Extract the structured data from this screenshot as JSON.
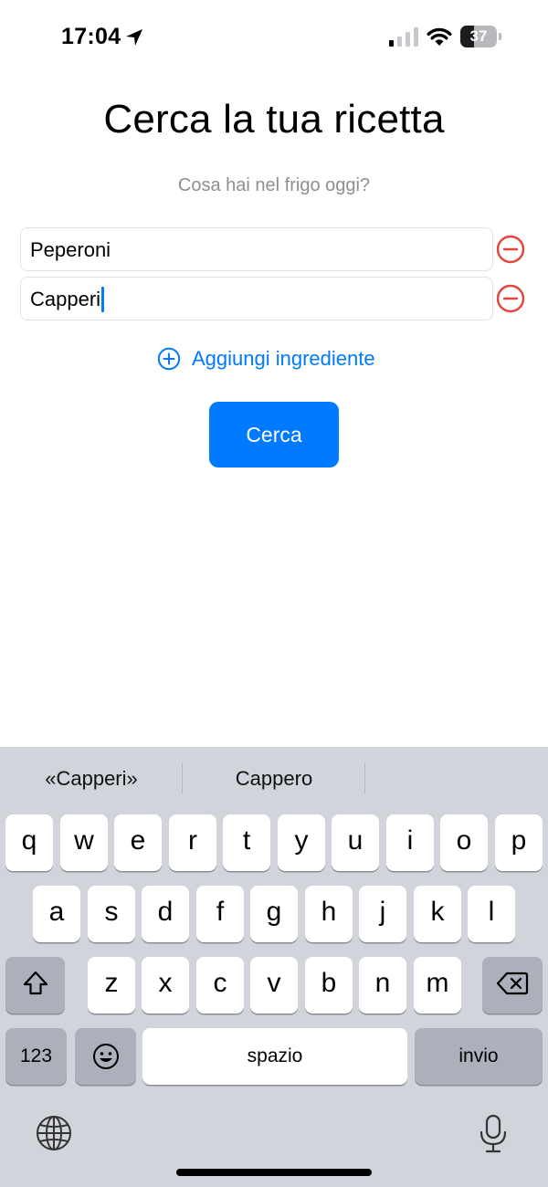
{
  "status_bar": {
    "time": "17:04",
    "battery_level": "37",
    "battery_fraction": 0.37,
    "location_icon": "location-arrow-icon",
    "signal_bars_active": 1
  },
  "main": {
    "title": "Cerca la tua ricetta",
    "subtitle": "Cosa hai nel frigo oggi?",
    "ingredients": [
      {
        "value": "Peperoni"
      },
      {
        "value": "Capperi"
      }
    ],
    "add_ingredient_label": "Aggiungi ingrediente",
    "search_button_label": "Cerca",
    "accent_color": "#007aff",
    "remove_color": "#e5443a"
  },
  "keyboard": {
    "suggestions": [
      "«Capperi»",
      "Cappero",
      ""
    ],
    "row1": [
      "q",
      "w",
      "e",
      "r",
      "t",
      "y",
      "u",
      "i",
      "o",
      "p"
    ],
    "row2": [
      "a",
      "s",
      "d",
      "f",
      "g",
      "h",
      "j",
      "k",
      "l"
    ],
    "row3": [
      "z",
      "x",
      "c",
      "v",
      "b",
      "n",
      "m"
    ],
    "numbers_label": "123",
    "space_label": "spazio",
    "return_label": "invio",
    "icons": [
      "shift-icon",
      "backspace-icon",
      "emoji-icon",
      "globe-icon",
      "microphone-icon"
    ]
  }
}
